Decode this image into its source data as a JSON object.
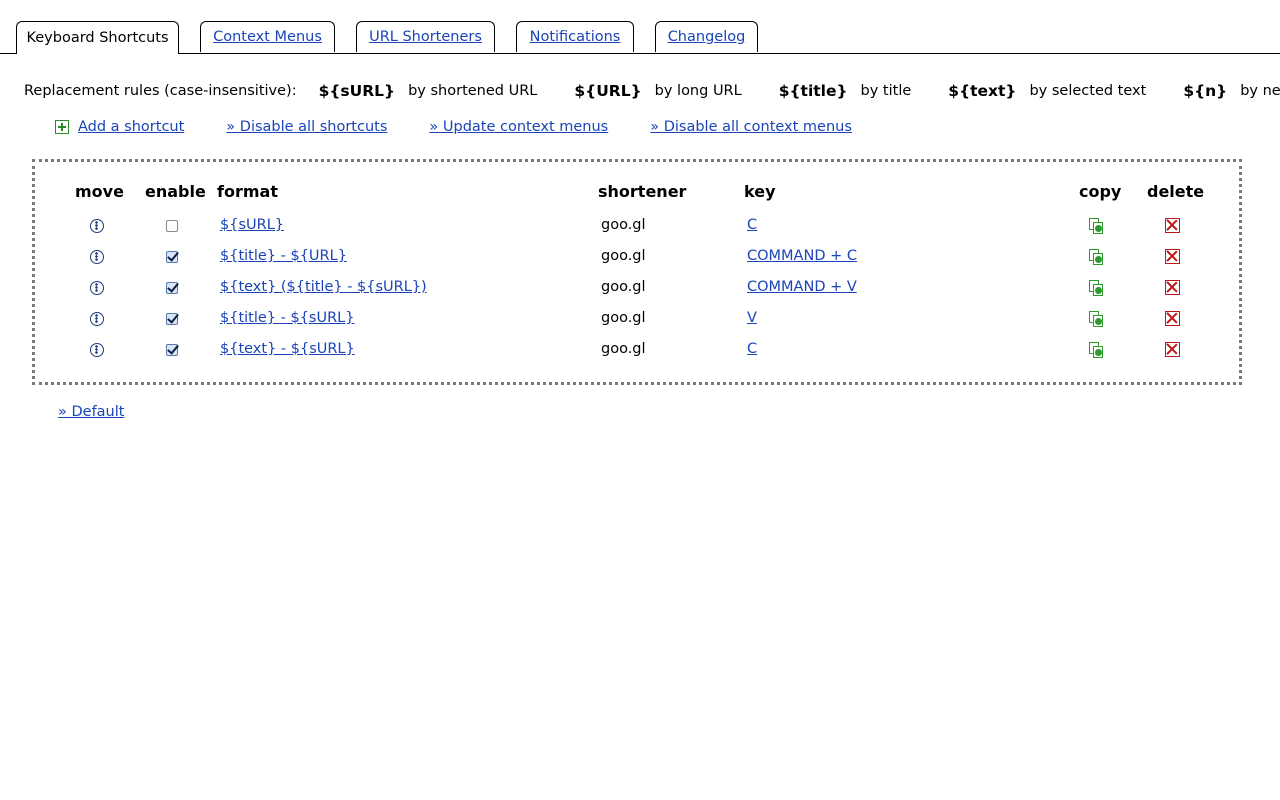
{
  "tabs": [
    {
      "label": "Keyboard Shortcuts",
      "active": true
    },
    {
      "label": "Context Menus",
      "active": false
    },
    {
      "label": "URL Shorteners",
      "active": false
    },
    {
      "label": "Notifications",
      "active": false
    },
    {
      "label": "Changelog",
      "active": false
    }
  ],
  "rules": {
    "lead": "Replacement rules (case-insensitive):",
    "items": [
      {
        "token": "${sURL}",
        "desc": "by shortened URL"
      },
      {
        "token": "${URL}",
        "desc": "by long URL"
      },
      {
        "token": "${title}",
        "desc": "by title"
      },
      {
        "token": "${text}",
        "desc": "by selected text"
      },
      {
        "token": "${n}",
        "desc": "by newline"
      }
    ]
  },
  "actions": {
    "add_shortcut": "Add a shortcut",
    "disable_shortcuts": "» Disable all shortcuts",
    "update_menus": "» Update context menus",
    "disable_menus": "» Disable all context menus"
  },
  "table": {
    "headers": {
      "move": "move",
      "enable": "enable",
      "format": "format",
      "shortener": "shortener",
      "key": "key",
      "copy": "copy",
      "delete": "delete"
    },
    "rows": [
      {
        "enabled": false,
        "format": "${sURL}",
        "shortener": "goo.gl",
        "key": "C"
      },
      {
        "enabled": true,
        "format": "${title} - ${URL}",
        "shortener": "goo.gl",
        "key": "COMMAND + C"
      },
      {
        "enabled": true,
        "format": "${text} (${title} - ${sURL})",
        "shortener": "goo.gl",
        "key": "COMMAND + V"
      },
      {
        "enabled": true,
        "format": "${title} - ${sURL}",
        "shortener": "goo.gl",
        "key": "V"
      },
      {
        "enabled": true,
        "format": "${text} - ${sURL}",
        "shortener": "goo.gl",
        "key": "C"
      }
    ]
  },
  "footer": {
    "default_link": "» Default"
  },
  "colors": {
    "link": "#1a44b8",
    "copy_icon": "#2e9a2e",
    "delete_icon": "#c01818",
    "move_icon": "#1d3a7a"
  }
}
